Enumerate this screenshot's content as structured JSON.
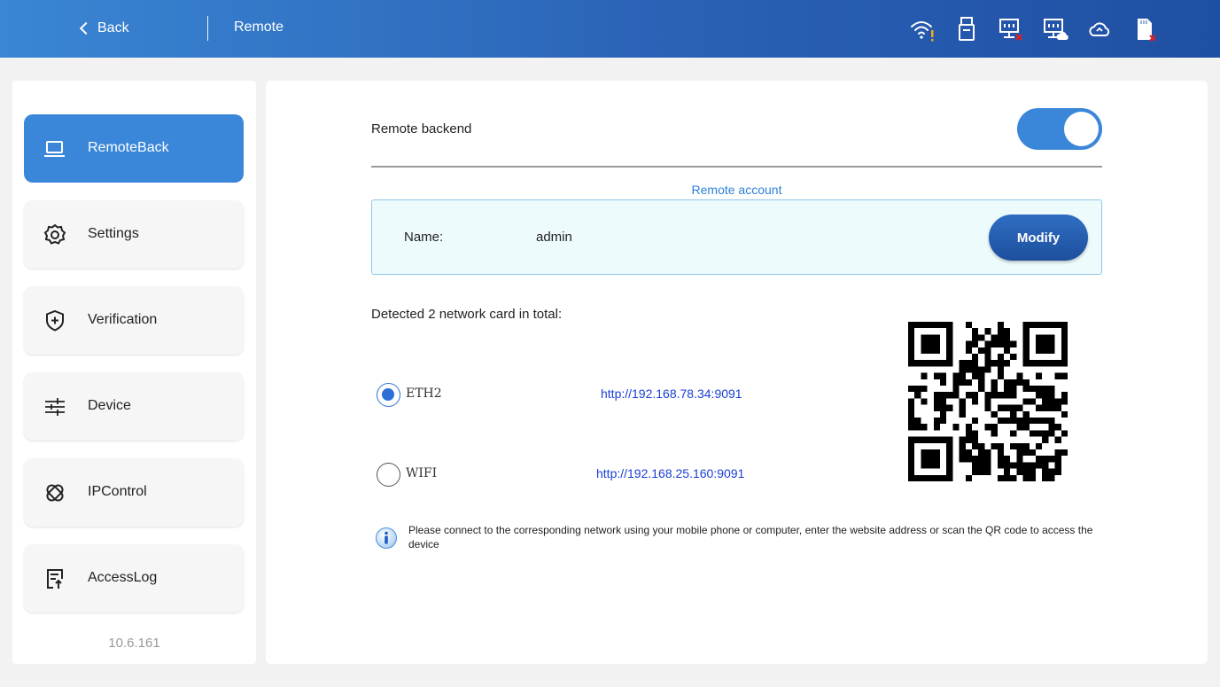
{
  "header": {
    "back_label": "Back",
    "title": "Remote",
    "status_icons": [
      "wifi-warning-icon",
      "usb-drive-icon",
      "network-disconnected-icon",
      "network-cloud-icon",
      "cloud-icon",
      "sd-card-error-icon"
    ]
  },
  "sidebar": {
    "items": [
      {
        "label": "RemoteBack",
        "icon": "laptop-icon",
        "active": true
      },
      {
        "label": "Settings",
        "icon": "gear-icon",
        "active": false
      },
      {
        "label": "Verification",
        "icon": "shield-plus-icon",
        "active": false
      },
      {
        "label": "Device",
        "icon": "sliders-icon",
        "active": false
      },
      {
        "label": "IPControl",
        "icon": "link-icon",
        "active": false
      },
      {
        "label": "AccessLog",
        "icon": "log-document-icon",
        "active": false
      }
    ],
    "version": "10.6.161"
  },
  "main": {
    "remote_backend_label": "Remote backend",
    "remote_backend_enabled": true,
    "account_title": "Remote account",
    "name_label": "Name:",
    "name_value": "admin",
    "modify_label": "Modify",
    "detected_text": "Detected 2 network card in total:",
    "networks": [
      {
        "name": "ETH2",
        "url": "http://192.168.78.34:9091",
        "selected": true
      },
      {
        "name": "WIFI",
        "url": "http://192.168.25.160:9091",
        "selected": false
      }
    ],
    "info_text": "Please connect to the corresponding network using your mobile phone or computer, enter the website address or scan the QR code to access the device"
  },
  "colors": {
    "header_start": "#3a86d4",
    "header_end": "#1f4fa3",
    "accent": "#3a86d9",
    "link": "#1a3fd6",
    "warning": "#f5a623",
    "error": "#e02020"
  }
}
